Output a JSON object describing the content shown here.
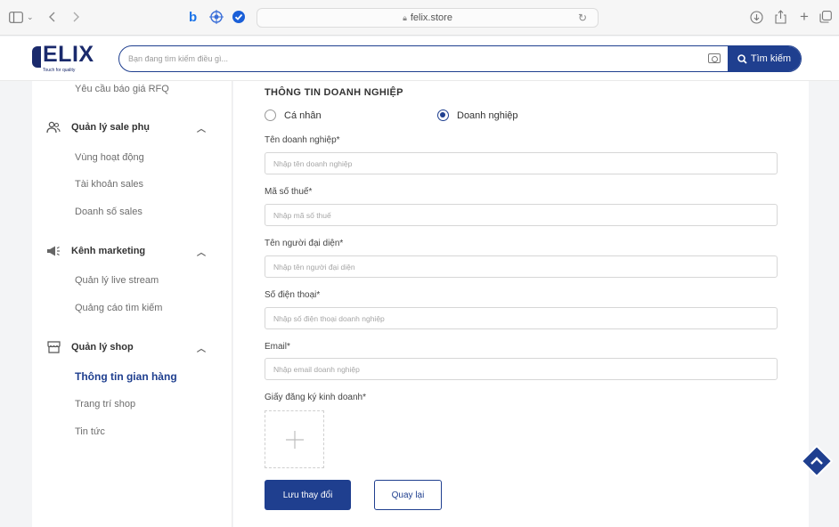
{
  "browser": {
    "url": "felix.store",
    "lock_icon": "lock-icon"
  },
  "header": {
    "logo_text": "ELIX",
    "logo_tagline": "Touch for quality",
    "search_placeholder": "Bạn đang tìm kiếm điều gì...",
    "search_button": "Tìm kiếm",
    "brand_color": "#1f3f8f"
  },
  "sidebar": {
    "top_item": "Yêu cầu báo giá RFQ",
    "groups": [
      {
        "title": "Quản lý sale phụ",
        "icon": "users-icon",
        "items": [
          "Vùng hoạt động",
          "Tài khoản sales",
          "Doanh số sales"
        ]
      },
      {
        "title": "Kênh marketing",
        "icon": "megaphone-icon",
        "items": [
          "Quản lý live stream",
          "Quảng cáo tìm kiếm"
        ]
      },
      {
        "title": "Quản lý shop",
        "icon": "shop-icon",
        "items": [
          "Thông tin gian hàng",
          "Trang trí shop",
          "Tin tức"
        ]
      }
    ]
  },
  "form": {
    "section_title": "THÔNG TIN DOANH NGHIỆP",
    "radio_options": [
      "Cá nhân",
      "Doanh nghiệp"
    ],
    "selected_option": "Doanh nghiệp",
    "fields": [
      {
        "label": "Tên doanh nghiệp*",
        "placeholder": "Nhập tên doanh nghiệp",
        "value": ""
      },
      {
        "label": "Mã số thuế*",
        "placeholder": "Nhập mã số thuế",
        "value": ""
      },
      {
        "label": "Tên người đại diện*",
        "placeholder": "Nhập tên người đại diện",
        "value": ""
      },
      {
        "label": "Số điện thoại*",
        "placeholder": "Nhập số điện thoại doanh nghiệp",
        "value": ""
      },
      {
        "label": "Email*",
        "placeholder": "Nhập email doanh nghiệp",
        "value": ""
      }
    ],
    "upload_label": "Giấy đăng ký kinh doanh*",
    "save_button": "Lưu thay đổi",
    "back_button": "Quay lại"
  }
}
